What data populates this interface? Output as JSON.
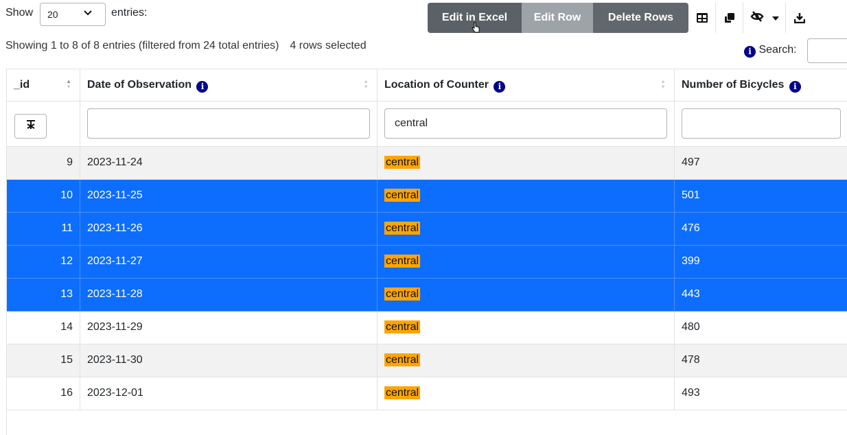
{
  "length_menu": {
    "show_label": "Show",
    "selected": "20",
    "entries_label": "entries:"
  },
  "buttons": {
    "edit_excel": "Edit in Excel",
    "edit_row": "Edit Row",
    "delete_rows": "Delete Rows"
  },
  "info": {
    "text": "Showing 1 to 8 of 8 entries (filtered from 24 total entries)",
    "selected_text": "4 rows selected"
  },
  "search": {
    "label": "Search:",
    "value": ""
  },
  "columns": [
    {
      "label": "_id"
    },
    {
      "label": "Date of Observation"
    },
    {
      "label": "Location of Counter"
    },
    {
      "label": "Number of Bicycles"
    }
  ],
  "filters": {
    "date": "",
    "location": "central",
    "bicycles": ""
  },
  "rows": [
    {
      "id": "9",
      "date": "2023-11-24",
      "location": "central",
      "bicycles": "497",
      "selected": false
    },
    {
      "id": "10",
      "date": "2023-11-25",
      "location": "central",
      "bicycles": "501",
      "selected": true
    },
    {
      "id": "11",
      "date": "2023-11-26",
      "location": "central",
      "bicycles": "476",
      "selected": true
    },
    {
      "id": "12",
      "date": "2023-11-27",
      "location": "central",
      "bicycles": "399",
      "selected": true
    },
    {
      "id": "13",
      "date": "2023-11-28",
      "location": "central",
      "bicycles": "443",
      "selected": true
    },
    {
      "id": "14",
      "date": "2023-11-29",
      "location": "central",
      "bicycles": "480",
      "selected": false
    },
    {
      "id": "15",
      "date": "2023-11-30",
      "location": "central",
      "bicycles": "478",
      "selected": false
    },
    {
      "id": "16",
      "date": "2023-12-01",
      "location": "central",
      "bicycles": "493",
      "selected": false
    }
  ],
  "colors": {
    "selected_row": "#0d6efd",
    "highlight": "#ffa500",
    "info_badge": "#00008b"
  },
  "icons": [
    "table-icon",
    "copy-icon",
    "eye-slash-icon",
    "caret-down-icon",
    "download-icon",
    "clear-filter-icon",
    "info-icon"
  ]
}
